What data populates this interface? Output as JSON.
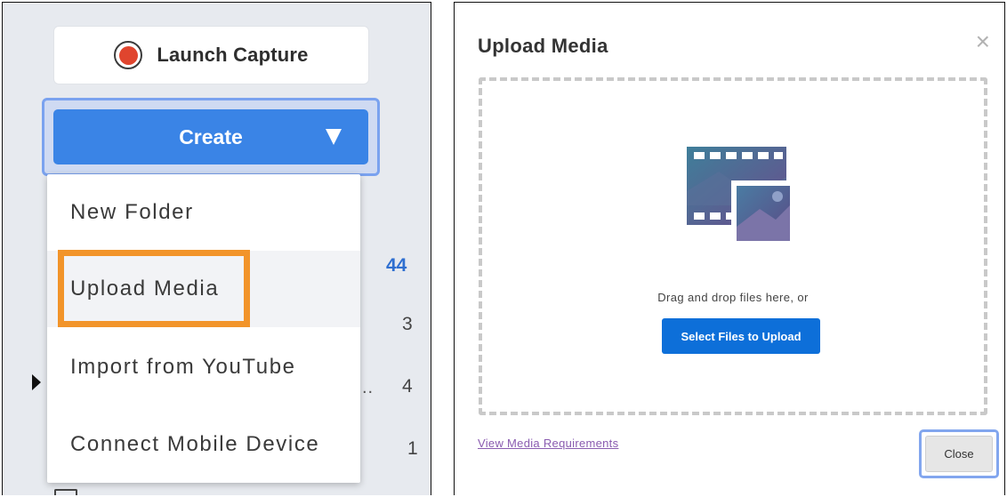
{
  "sidebar": {
    "launch_capture_label": "Launch Capture",
    "create_label": "Create",
    "menu_items": [
      "New Folder",
      "Upload Media",
      "Import from YouTube",
      "Connect Mobile Device"
    ],
    "counts": [
      "44",
      "3",
      "4",
      "1"
    ],
    "truncated_marker": "..",
    "colors": {
      "create_button": "#3a84e6",
      "highlight_box": "#f2942a",
      "record": "#e0452e"
    }
  },
  "modal": {
    "title": "Upload Media",
    "close_icon": "×",
    "drop_text": "Drag and drop files here, or",
    "select_button": "Select Files to Upload",
    "requirements_link": "View Media Requirements",
    "close_button": "Close",
    "colors": {
      "primary": "#0d6fd9",
      "link": "#8a5cb0"
    }
  }
}
